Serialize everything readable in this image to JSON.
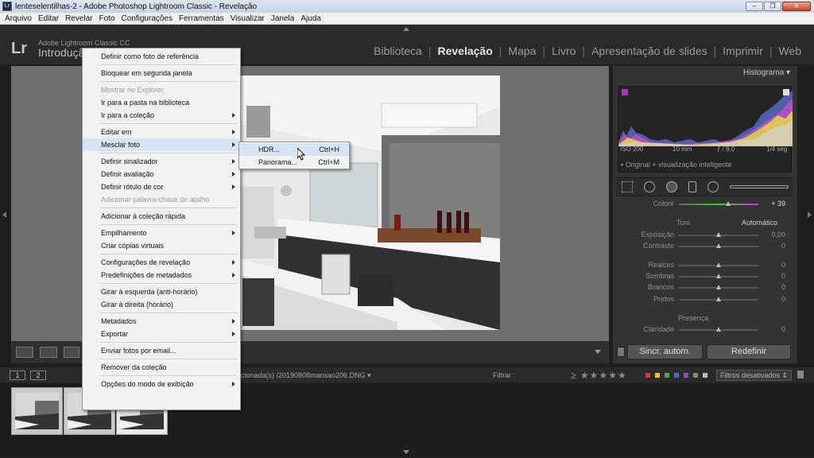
{
  "window": {
    "title": "lenteselentilhas-2 - Adobe Photoshop Lightroom Classic - Revelação",
    "icon_label": "Lr",
    "controls": [
      "minimize",
      "maximize",
      "close"
    ]
  },
  "menubar": [
    "Arquivo",
    "Editar",
    "Revelar",
    "Foto",
    "Configurações",
    "Ferramentas",
    "Visualizar",
    "Janela",
    "Ajuda"
  ],
  "identity": {
    "logo": "Lr",
    "product": "Adobe Lightroom Classic CC",
    "label": "Introdução"
  },
  "modules": [
    {
      "label": "Biblioteca",
      "active": false
    },
    {
      "label": "Revelação",
      "active": true
    },
    {
      "label": "Mapa",
      "active": false
    },
    {
      "label": "Livro",
      "active": false
    },
    {
      "label": "Apresentação de slides",
      "active": false
    },
    {
      "label": "Imprimir",
      "active": false
    },
    {
      "label": "Web",
      "active": false
    }
  ],
  "context_menu": {
    "items": [
      {
        "label": "Definir como foto de referência",
        "arrow": false,
        "disabled": false,
        "sep_after": true
      },
      {
        "label": "Bloquear em segunda janela",
        "arrow": false,
        "disabled": false,
        "sep_after": true
      },
      {
        "label": "Mostrar no Explorer",
        "arrow": false,
        "disabled": true,
        "sep_after": false
      },
      {
        "label": "Ir para a pasta na biblioteca",
        "arrow": false,
        "disabled": false,
        "sep_after": false
      },
      {
        "label": "Ir para a coleção",
        "arrow": true,
        "disabled": false,
        "sep_after": true
      },
      {
        "label": "Editar em",
        "arrow": true,
        "disabled": false,
        "sep_after": false
      },
      {
        "label": "Mesclar foto",
        "arrow": true,
        "disabled": false,
        "sep_after": true,
        "hover": true
      },
      {
        "label": "Definir sinalizador",
        "arrow": true,
        "disabled": false,
        "sep_after": false
      },
      {
        "label": "Definir avaliação",
        "arrow": true,
        "disabled": false,
        "sep_after": false
      },
      {
        "label": "Definir rótulo de cor",
        "arrow": true,
        "disabled": false,
        "sep_after": false
      },
      {
        "label": "Adicionar palavra-chave de atalho",
        "arrow": false,
        "disabled": true,
        "sep_after": true
      },
      {
        "label": "Adicionar à coleção rápida",
        "arrow": false,
        "disabled": false,
        "sep_after": true
      },
      {
        "label": "Empilhamento",
        "arrow": true,
        "disabled": false,
        "sep_after": false
      },
      {
        "label": "Criar cópias virtuais",
        "arrow": false,
        "disabled": false,
        "sep_after": true
      },
      {
        "label": "Configurações de revelação",
        "arrow": true,
        "disabled": false,
        "sep_after": false
      },
      {
        "label": "Predefinições de metadados",
        "arrow": true,
        "disabled": false,
        "sep_after": true
      },
      {
        "label": "Girar à esquerda (anti-horário)",
        "arrow": false,
        "disabled": false,
        "sep_after": false
      },
      {
        "label": "Girar à direita (horário)",
        "arrow": false,
        "disabled": false,
        "sep_after": true
      },
      {
        "label": "Metadados",
        "arrow": true,
        "disabled": false,
        "sep_after": false
      },
      {
        "label": "Exportar",
        "arrow": true,
        "disabled": false,
        "sep_after": true
      },
      {
        "label": "Enviar fotos por email...",
        "arrow": false,
        "disabled": false,
        "sep_after": true
      },
      {
        "label": "Remover da coleção",
        "arrow": false,
        "disabled": false,
        "sep_after": true
      },
      {
        "label": "Opções do modo de exibição",
        "arrow": true,
        "disabled": false,
        "sep_after": false
      }
    ]
  },
  "submenu": {
    "items": [
      {
        "label": "HDR...",
        "shortcut": "Ctrl+H",
        "hover": true
      },
      {
        "label": "Panorama...",
        "shortcut": "Ctrl+M",
        "hover": false
      }
    ]
  },
  "right_panel": {
    "histogram_title": "Histograma",
    "info": [
      "ISO 200",
      "10 mm",
      "ƒ / 9,0",
      "1/4 seg"
    ],
    "smart_preview": "Original + visualização inteligente",
    "colorir": {
      "label": "Colorir",
      "value": "+ 39",
      "level": 0.62
    },
    "tom_label": "Tom",
    "auto_label": "Automático",
    "basic": [
      {
        "label": "Exposição",
        "value": "0,00",
        "level": 0.5
      },
      {
        "label": "Contraste",
        "value": "0",
        "level": 0.5
      },
      {
        "label": "Realces",
        "value": "0",
        "level": 0.5
      },
      {
        "label": "Sombras",
        "value": "0",
        "level": 0.5
      },
      {
        "label": "Brancos",
        "value": "0",
        "level": 0.5
      },
      {
        "label": "Pretos",
        "value": "0",
        "level": 0.5
      }
    ],
    "presence_label": "Presença",
    "clarity": {
      "label": "Claridade",
      "value": "0",
      "level": 0.5
    },
    "sync_button": "Sincr. autom.",
    "reset_button": "Redefinir"
  },
  "filmstrip": {
    "page_buttons": [
      "1",
      "2"
    ],
    "selection_text": "cionada(s) /20190808mansao206.DNG ▾",
    "filter_label": "Filtrar :",
    "stars": "≥ ★★★★★",
    "filters_off": "Filtros desativados",
    "label_colors": [
      "#d03a2e",
      "#e2c23a",
      "#4fa543",
      "#3f6fd1",
      "#9a46c2",
      "#888888",
      "#bbbbbb"
    ]
  }
}
